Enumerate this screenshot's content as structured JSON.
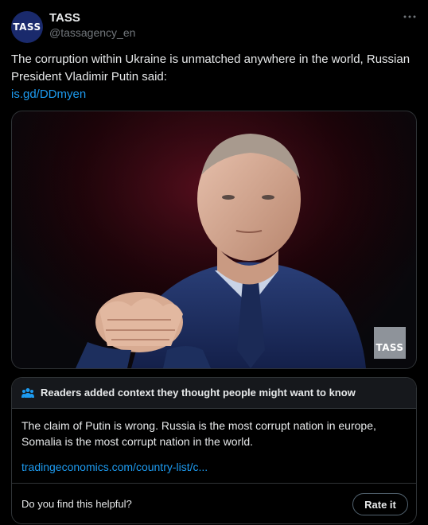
{
  "author": {
    "avatar_text": "TASS",
    "name": "TASS",
    "handle": "@tassagency_en"
  },
  "more_icon": "more-horizontal-icon",
  "tweet": {
    "text": "The corruption within Ukraine is unmatched anywhere in the world, Russian President Vladimir Putin said:",
    "link": "is.gd/DDmyen"
  },
  "media": {
    "watermark": "TASS",
    "description_colors": {
      "background": "#1a0308",
      "suit": "#1d2f5e",
      "tie": "#1b2a56"
    }
  },
  "community_note": {
    "icon": "people-icon",
    "header": "Readers added context they thought people might want to know",
    "body": "The claim of Putin is wrong. Russia is the most corrupt nation in europe, Somalia is the most corrupt nation in the world.",
    "link": "tradingeconomics.com/country-list/c...",
    "helpful_prompt": "Do you find this helpful?",
    "rate_button": "Rate it"
  },
  "colors": {
    "accent": "#1d9bf0",
    "text": "#e7e9ea",
    "muted": "#71767b",
    "border": "#2f3336"
  }
}
